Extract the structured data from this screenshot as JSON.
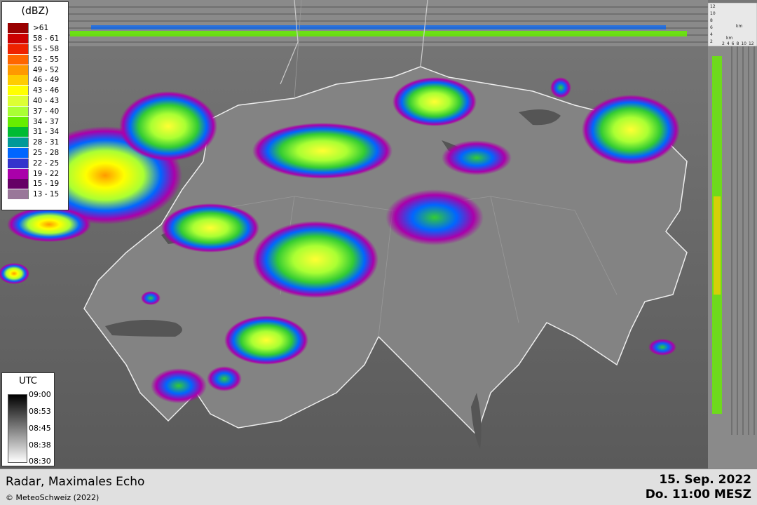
{
  "legend": {
    "unit": "(dBZ)",
    "classes": [
      {
        "label": ">61",
        "color": "#990000"
      },
      {
        "label": "58 - 61",
        "color": "#cc0000"
      },
      {
        "label": "55 - 58",
        "color": "#ee2200"
      },
      {
        "label": "52 - 55",
        "color": "#ff6600"
      },
      {
        "label": "49 - 52",
        "color": "#ff9900"
      },
      {
        "label": "46 - 49",
        "color": "#ffcc00"
      },
      {
        "label": "43 - 46",
        "color": "#ffff00"
      },
      {
        "label": "40 - 43",
        "color": "#ddff33"
      },
      {
        "label": "37 - 40",
        "color": "#aaff33"
      },
      {
        "label": "34 - 37",
        "color": "#66ee00"
      },
      {
        "label": "31 - 34",
        "color": "#00bb33"
      },
      {
        "label": "28 - 31",
        "color": "#009999"
      },
      {
        "label": "25 - 28",
        "color": "#0066ff"
      },
      {
        "label": "22 - 25",
        "color": "#3333cc"
      },
      {
        "label": "19 - 22",
        "color": "#aa00aa"
      },
      {
        "label": "15 - 19",
        "color": "#660066"
      },
      {
        "label": "13 - 15",
        "color": "#997799"
      }
    ]
  },
  "utc": {
    "title": "UTC",
    "ticks": [
      "09:00",
      "08:53",
      "08:45",
      "08:38",
      "08:30"
    ]
  },
  "profile_axis": {
    "height_labels": [
      "12",
      "10",
      "8",
      "6",
      "4",
      "2"
    ],
    "height_unit": "km",
    "distance_labels": [
      "2",
      "4",
      "6",
      "8",
      "10",
      "12"
    ]
  },
  "footer": {
    "title": "Radar, Maximales Echo",
    "copyright": "© MeteoSchweiz (2022)",
    "date": "15. Sep. 2022",
    "time": "Do. 11:00 MESZ"
  }
}
